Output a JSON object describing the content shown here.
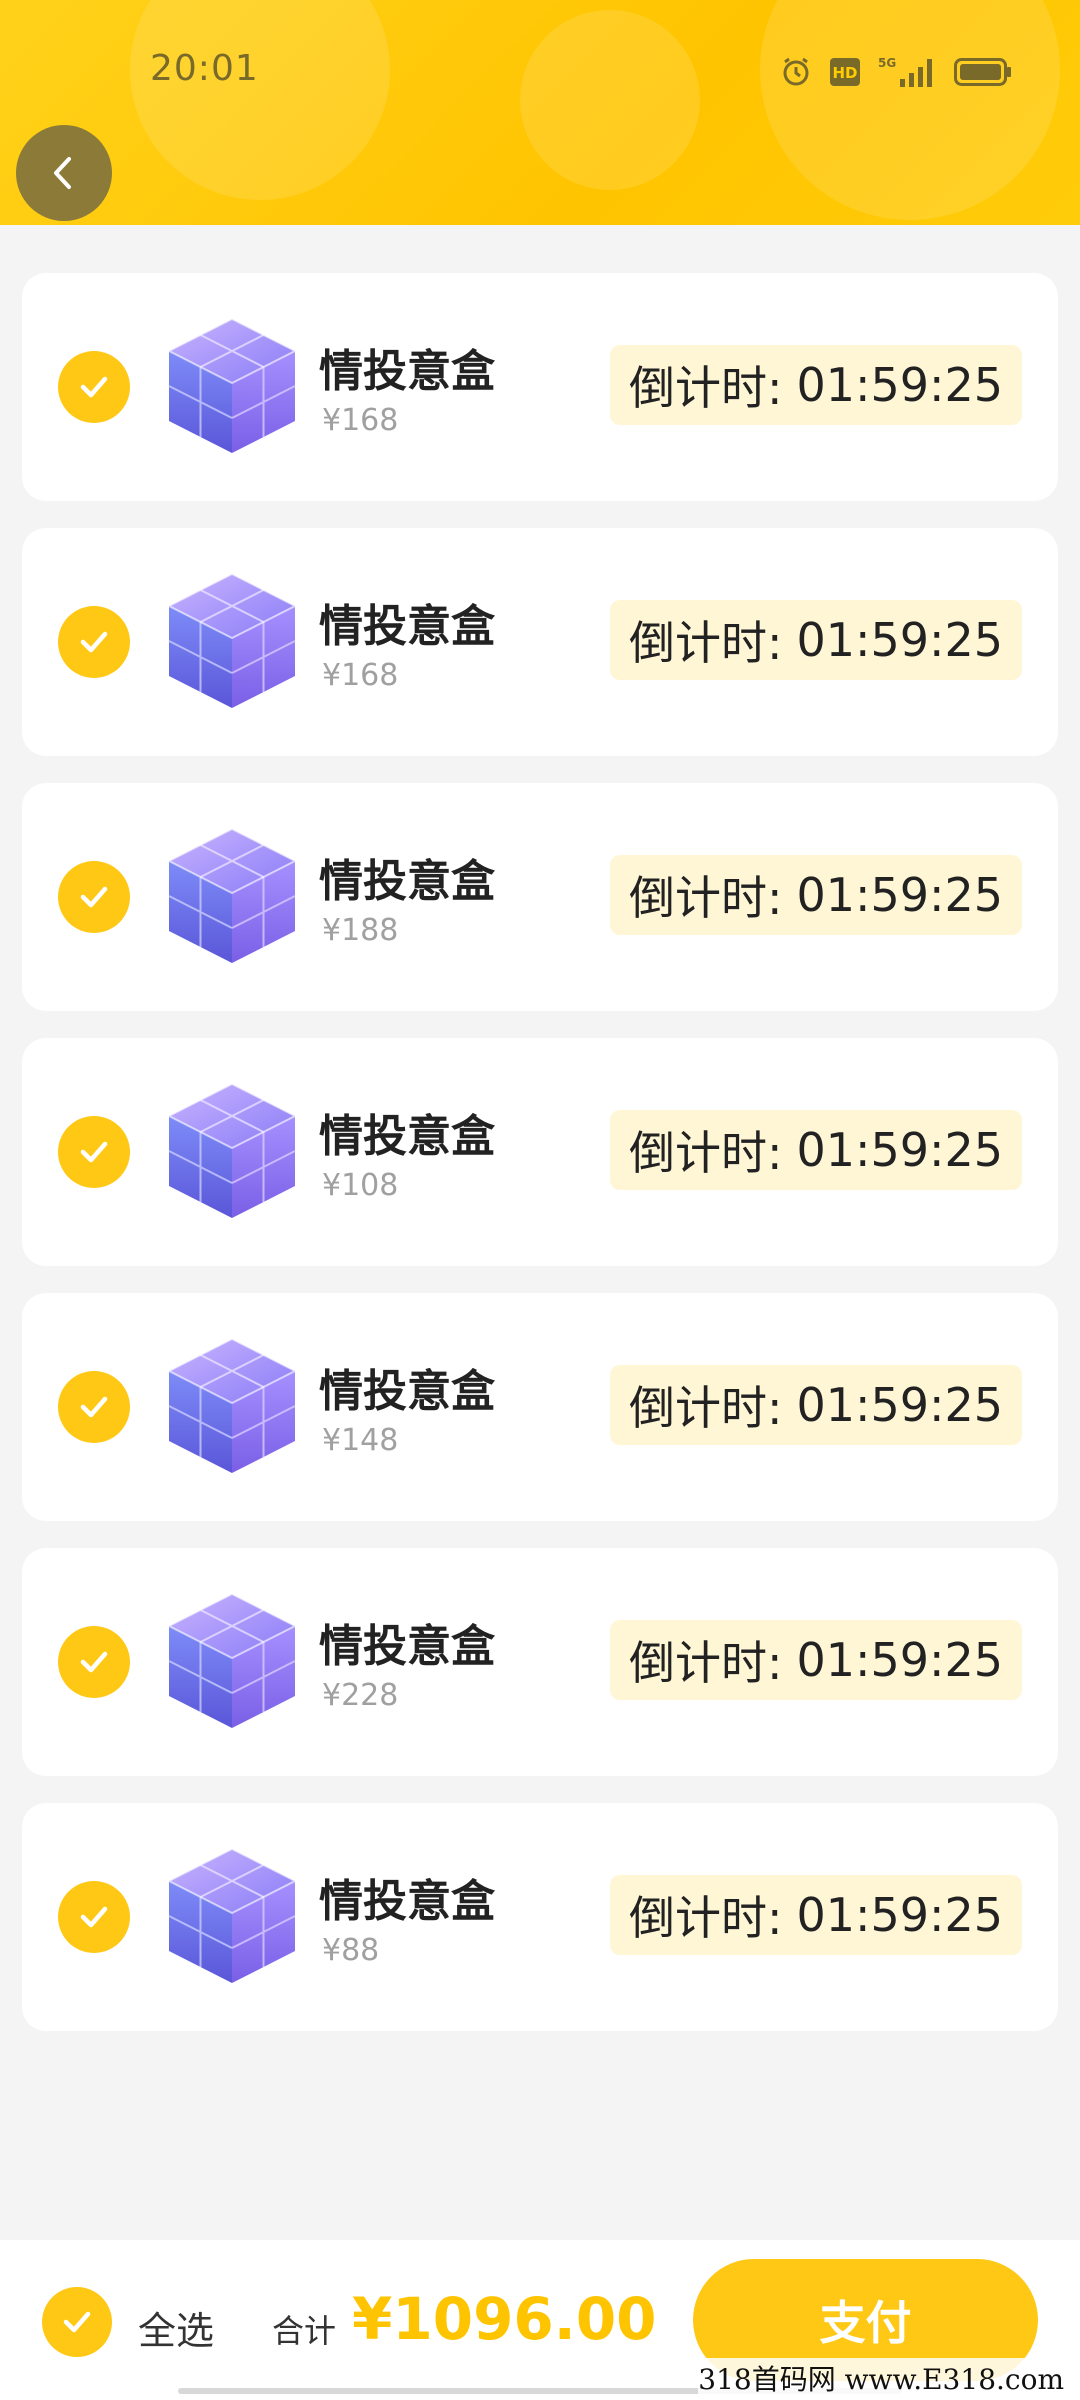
{
  "status_bar": {
    "time": "20:01",
    "icons": [
      "alarm-icon",
      "hd-icon",
      "5g-signal-icon",
      "battery-icon"
    ]
  },
  "header": {
    "back_icon": "chevron-left-icon"
  },
  "colors": {
    "accent": "#ffc814",
    "header": "#ffcc00",
    "countdown_bg": "#fff6d6",
    "total": "#ffc400"
  },
  "items": [
    {
      "name": "情投意盒",
      "price": "¥168",
      "countdown_label": "倒计时:",
      "countdown": "01:59:25"
    },
    {
      "name": "情投意盒",
      "price": "¥168",
      "countdown_label": "倒计时:",
      "countdown": "01:59:25"
    },
    {
      "name": "情投意盒",
      "price": "¥188",
      "countdown_label": "倒计时:",
      "countdown": "01:59:25"
    },
    {
      "name": "情投意盒",
      "price": "¥108",
      "countdown_label": "倒计时:",
      "countdown": "01:59:25"
    },
    {
      "name": "情投意盒",
      "price": "¥148",
      "countdown_label": "倒计时:",
      "countdown": "01:59:25"
    },
    {
      "name": "情投意盒",
      "price": "¥228",
      "countdown_label": "倒计时:",
      "countdown": "01:59:25"
    },
    {
      "name": "情投意盒",
      "price": "¥88",
      "countdown_label": "倒计时:",
      "countdown": "01:59:25"
    }
  ],
  "footer": {
    "select_all": "全选",
    "total_label": "合计",
    "total_value": "¥1096.00",
    "pay_label": "支付"
  },
  "watermark": "318首码网 www.E318.com"
}
